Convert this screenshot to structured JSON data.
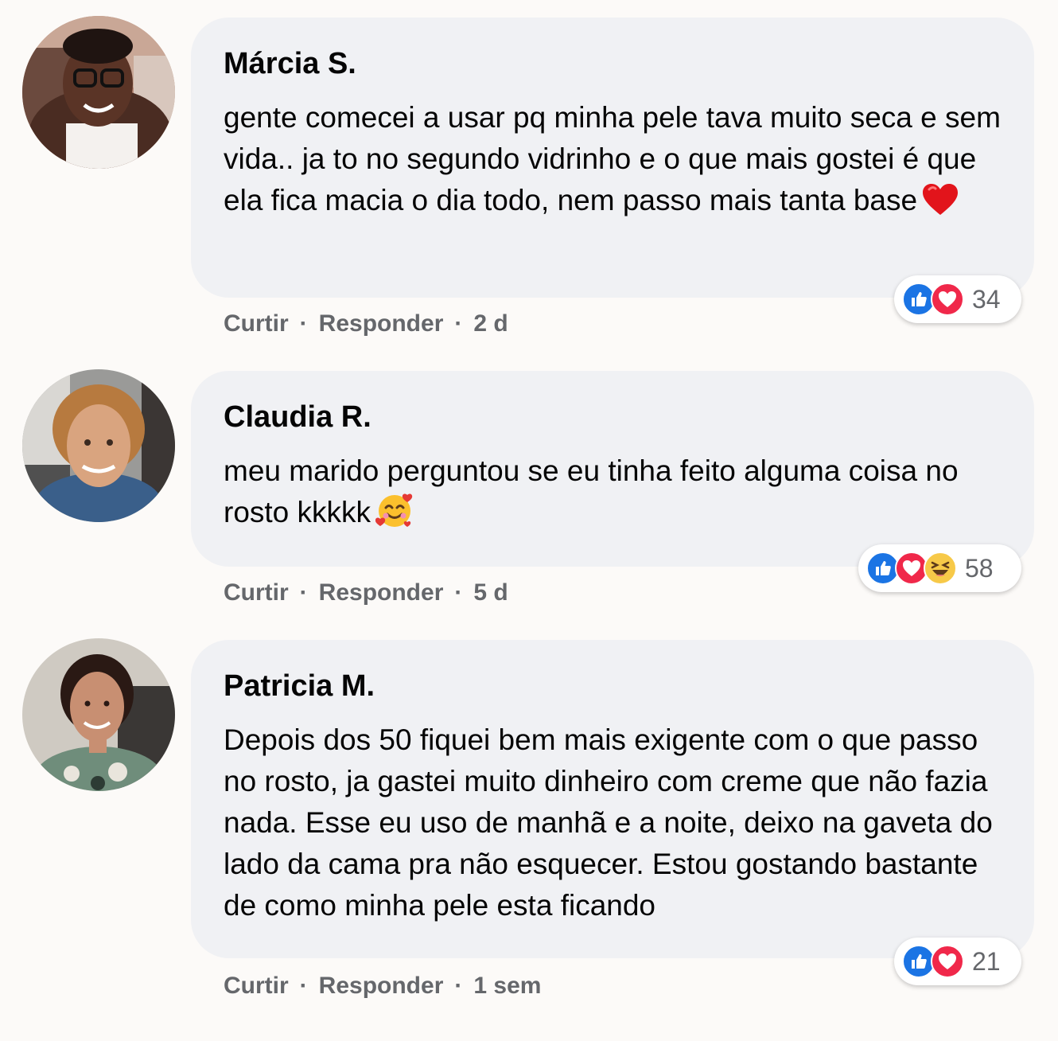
{
  "comments": [
    {
      "author": "Márcia S.",
      "text": "gente comecei a usar pq minha pele tava muito seca e sem vida.. ja to no segundo vidrinho e o que mais gostei é que ela fica macia o dia todo, nem passo mais tanta base",
      "emoji": "red-heart",
      "reactions": [
        "like",
        "love"
      ],
      "reaction_count": "34",
      "like_label": "Curtir",
      "reply_label": "Responder",
      "time": "2 d"
    },
    {
      "author": "Claudia R.",
      "text": "meu marido perguntou se eu tinha feito alguma coisa no rosto kkkkk",
      "emoji": "smiling-face-with-hearts",
      "reactions": [
        "like",
        "love",
        "haha"
      ],
      "reaction_count": "58",
      "like_label": "Curtir",
      "reply_label": "Responder",
      "time": "5 d"
    },
    {
      "author": "Patricia M.",
      "text": "Depois dos 50 fiquei bem mais exigente com o que passo no rosto, ja gastei muito dinheiro com creme que não fazia nada. Esse eu uso de manhã e a noite, deixo na gaveta do lado da cama pra não esquecer. Estou gostando bastante de como minha pele esta ficando",
      "emoji": "",
      "reactions": [
        "like",
        "love"
      ],
      "reaction_count": "21",
      "like_label": "Curtir",
      "reply_label": "Responder",
      "time": "1 sem"
    }
  ],
  "separator": "·",
  "colors": {
    "like": "#1b74e4",
    "love": "#f0284a",
    "haha": "#f7c948",
    "bubble": "#f0f1f4",
    "meta_text": "#65676b"
  }
}
